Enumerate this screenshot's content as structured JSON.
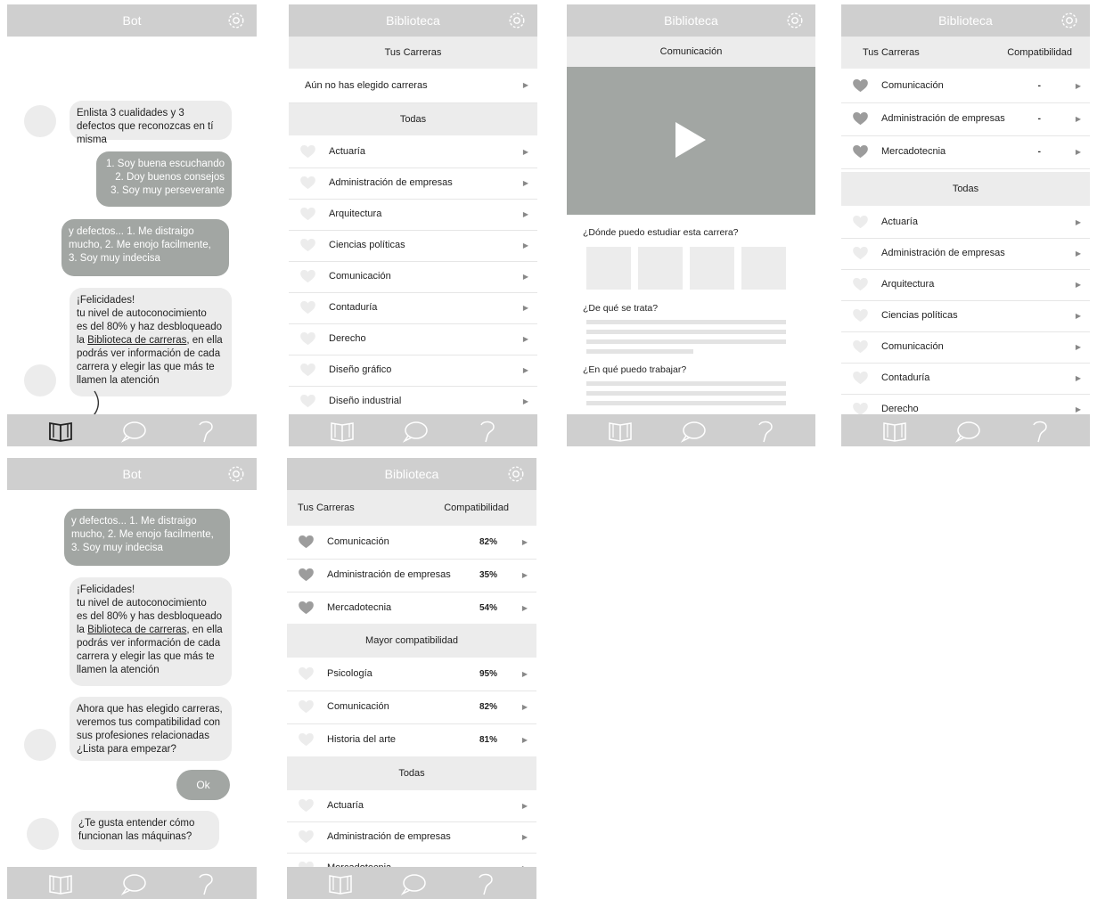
{
  "titles": {
    "bot": "Bot",
    "biblioteca": "Biblioteca"
  },
  "icons": {
    "gear": "gear-icon",
    "book": "book-icon",
    "chat": "chat-icon",
    "question": "question-icon",
    "heart": "heart-icon",
    "arrow": "arrow-right-icon",
    "play": "play-icon"
  },
  "screen1": {
    "msg1": "Enlista 3 cualidades y 3 defectos que reconozcas en tí misma",
    "reply1": [
      "1. Soy buena escuchando",
      "2. Doy buenos consejos",
      "3. Soy muy perseverante"
    ],
    "reply2": [
      "y defectos... 1. Me distraigo",
      "mucho, 2. Me enojo facilmente,",
      "3. Soy muy indecisa"
    ],
    "msg2": {
      "l1": "¡Felicidades!",
      "l2": "tu nivel de autoconocimiento",
      "l3": "es del 80% y haz desbloqueado",
      "l4a": "la ",
      "link": "Biblioteca de carreras",
      "l4b": ", en ella",
      "l5": "podrás ver información de cada",
      "l6": "carrera y elegir las que más te",
      "l7": "llamen la atención"
    }
  },
  "screen2": {
    "section1": "Tus Carreras",
    "empty": "Aún no has elegido carreras",
    "section2": "Todas",
    "careers": [
      "Actuaría",
      "Administración de empresas",
      "Arquitectura",
      "Ciencias políticas",
      "Comunicación",
      "Contaduría",
      "Derecho",
      "Diseño gráfico",
      "Diseño industrial"
    ]
  },
  "screen3": {
    "header": "Comunicación",
    "q1": "¿Dónde puedo estudiar esta carrera?",
    "q2": "¿De qué se trata?",
    "q3": "¿En qué puedo trabajar?"
  },
  "screen4": {
    "col1": "Tus Carreras",
    "col2": "Compatibilidad",
    "chosen": [
      {
        "name": "Comunicación",
        "compat": "-"
      },
      {
        "name": "Administración de empresas",
        "compat": "-"
      },
      {
        "name": "Mercadotecnia",
        "compat": "-"
      }
    ],
    "section2": "Todas",
    "careers": [
      "Actuaría",
      "Administración de empresas",
      "Arquitectura",
      "Ciencias políticas",
      "Comunicación",
      "Contaduría",
      "Derecho"
    ]
  },
  "screen5": {
    "reply": [
      "y defectos... 1. Me distraigo",
      "mucho, 2. Me enojo facilmente,",
      "3. Soy muy indecisa"
    ],
    "msg1": {
      "l1": "¡Felicidades!",
      "l2": "tu nivel de autoconocimiento",
      "l3": "es del 80% y has desbloqueado",
      "l4a": "la ",
      "link": "Biblioteca de carreras",
      "l4b": ", en ella",
      "l5": "podrás ver información de cada",
      "l6": "carrera y elegir las que más te",
      "l7": "llamen la atención"
    },
    "msg2": [
      "Ahora que has elegido carreras,",
      "veremos tus compatibilidad con",
      "sus profesiones relacionadas",
      "¿Lista para empezar?"
    ],
    "ok": "Ok",
    "msg3": [
      "¿Te gusta entender cómo",
      "funcionan las máquinas?"
    ]
  },
  "screen6": {
    "col1": "Tus Carreras",
    "col2": "Compatibilidad",
    "chosen": [
      {
        "name": "Comunicación",
        "pct": "82%"
      },
      {
        "name": "Administración de empresas",
        "pct": "35%"
      },
      {
        "name": "Mercadotecnia",
        "pct": "54%"
      }
    ],
    "section2": "Mayor compatibilidad",
    "best": [
      {
        "name": "Psicología",
        "pct": "95%"
      },
      {
        "name": "Comunicación",
        "pct": "82%"
      },
      {
        "name": "Historia del arte",
        "pct": "81%"
      }
    ],
    "section3": "Todas",
    "careers": [
      "Actuaría",
      "Administración de empresas",
      "Mercadotecnia"
    ]
  }
}
